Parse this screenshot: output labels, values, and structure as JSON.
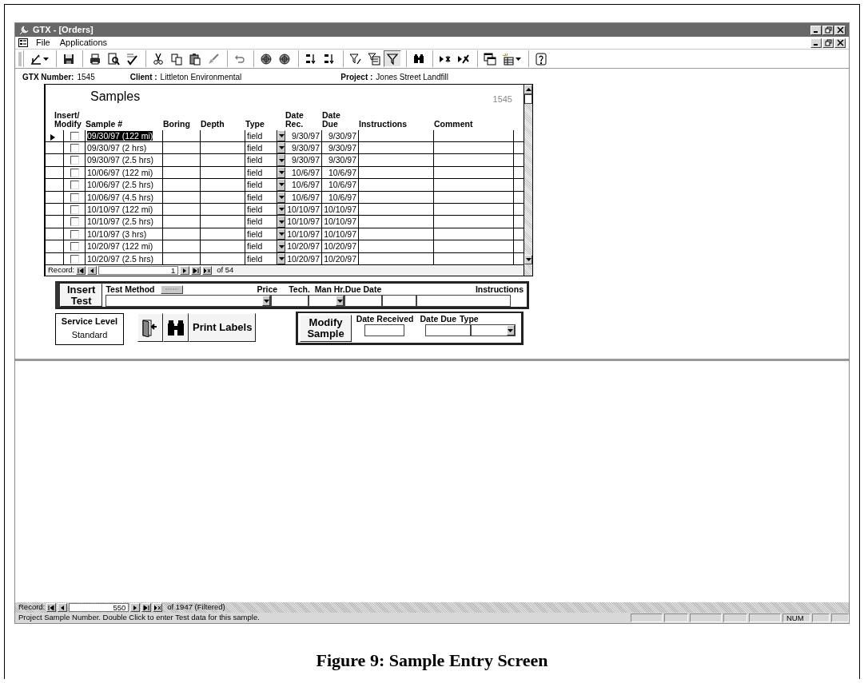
{
  "window": {
    "title": "GTX - [Orders]"
  },
  "menu": [
    {
      "label": "File"
    },
    {
      "label": "Applications"
    }
  ],
  "toolbar": [
    [
      {
        "kind": "design",
        "pressed": false
      }
    ],
    [
      {
        "kind": "save",
        "pressed": false
      }
    ],
    [
      {
        "kind": "print",
        "pressed": false
      },
      {
        "kind": "preview",
        "pressed": false
      },
      {
        "kind": "spell",
        "pressed": false
      }
    ],
    [
      {
        "kind": "cut",
        "pressed": false
      },
      {
        "kind": "copy",
        "pressed": false
      },
      {
        "kind": "paste",
        "pressed": false
      },
      {
        "kind": "brush",
        "pressed": false
      }
    ],
    [
      {
        "kind": "undo",
        "pressed": false
      }
    ],
    [
      {
        "kind": "globe",
        "pressed": false
      },
      {
        "kind": "globe",
        "pressed": false
      }
    ],
    [
      {
        "kind": "sortasc",
        "pressed": false
      },
      {
        "kind": "sortdesc",
        "pressed": false
      }
    ],
    [
      {
        "kind": "filtersel",
        "pressed": false
      },
      {
        "kind": "filterform",
        "pressed": false
      },
      {
        "kind": "filter",
        "pressed": true
      }
    ],
    [
      {
        "kind": "find",
        "pressed": false
      }
    ],
    [
      {
        "kind": "newrec",
        "pressed": false
      },
      {
        "kind": "delrec",
        "pressed": false
      }
    ],
    [
      {
        "kind": "dbwin",
        "pressed": false
      },
      {
        "kind": "newobj",
        "pressed": false
      }
    ],
    [
      {
        "kind": "help",
        "pressed": false
      }
    ]
  ],
  "header": {
    "gtx_label": "GTX Number:",
    "gtx_value": "1545",
    "client_label": "Client :",
    "client_value": "Littleton Environmental",
    "project_label": "Project :",
    "project_value": "Jones Street Landfill"
  },
  "samples": {
    "title": "Samples",
    "record_id": "1545",
    "columns": [
      "Insert/\nModify",
      "Sample #",
      "Boring",
      "Depth",
      "Type",
      "Date\nRec.",
      "Date\nDue",
      "Instructions",
      "Comment"
    ],
    "rows": [
      {
        "selected": true,
        "checked": false,
        "sample": "09/30/97 (122 mi)",
        "type": "field",
        "date_rec": "9/30/97",
        "date_due": "9/30/97"
      },
      {
        "selected": false,
        "checked": false,
        "sample": "09/30/97 (2 hrs)",
        "type": "field",
        "date_rec": "9/30/97",
        "date_due": "9/30/97"
      },
      {
        "selected": false,
        "checked": false,
        "sample": "09/30/97 (2.5 hrs)",
        "type": "field",
        "date_rec": "9/30/97",
        "date_due": "9/30/97"
      },
      {
        "selected": false,
        "checked": false,
        "sample": "10/06/97 (122 mi)",
        "type": "field",
        "date_rec": "10/6/97",
        "date_due": "10/6/97"
      },
      {
        "selected": false,
        "checked": false,
        "sample": "10/06/97 (2.5 hrs)",
        "type": "field",
        "date_rec": "10/6/97",
        "date_due": "10/6/97"
      },
      {
        "selected": false,
        "checked": false,
        "sample": "10/06/97 (4.5 hrs)",
        "type": "field",
        "date_rec": "10/6/97",
        "date_due": "10/6/97"
      },
      {
        "selected": false,
        "checked": false,
        "sample": "10/10/97 (122 mi)",
        "type": "field",
        "date_rec": "10/10/97",
        "date_due": "10/10/97"
      },
      {
        "selected": false,
        "checked": false,
        "sample": "10/10/97 (2.5 hrs)",
        "type": "field",
        "date_rec": "10/10/97",
        "date_due": "10/10/97"
      },
      {
        "selected": false,
        "checked": false,
        "sample": "10/10/97 (3 hrs)",
        "type": "field",
        "date_rec": "10/10/97",
        "date_due": "10/10/97"
      },
      {
        "selected": false,
        "checked": false,
        "sample": "10/20/97 (122 mi)",
        "type": "field",
        "date_rec": "10/20/97",
        "date_due": "10/20/97"
      },
      {
        "selected": false,
        "checked": false,
        "sample": "10/20/97 (2.5 hrs)",
        "type": "field",
        "date_rec": "10/20/97",
        "date_due": "10/20/97"
      }
    ],
    "navigator": {
      "label": "Record:",
      "current": "1",
      "total": "of 54"
    }
  },
  "insert_test": {
    "button": "Insert\nTest",
    "labels": [
      "Test Method",
      "Price",
      "Tech.",
      "Man Hr.",
      "Due Date",
      "Instructions"
    ]
  },
  "service_level": {
    "label": "Service Level",
    "value": "Standard"
  },
  "print_labels": {
    "label": "Print Labels"
  },
  "modify_sample": {
    "button": "Modify\nSample",
    "labels": [
      "Date Received",
      "Date Due",
      "Type"
    ]
  },
  "record_navigator": {
    "label": "Record:",
    "current": "550",
    "total": "of 1947 (Filtered)"
  },
  "status_bar": {
    "message": "Project Sample Number. Double Click to enter Test data for this sample.",
    "num": "NUM"
  },
  "caption": "Figure 9: Sample Entry Screen"
}
